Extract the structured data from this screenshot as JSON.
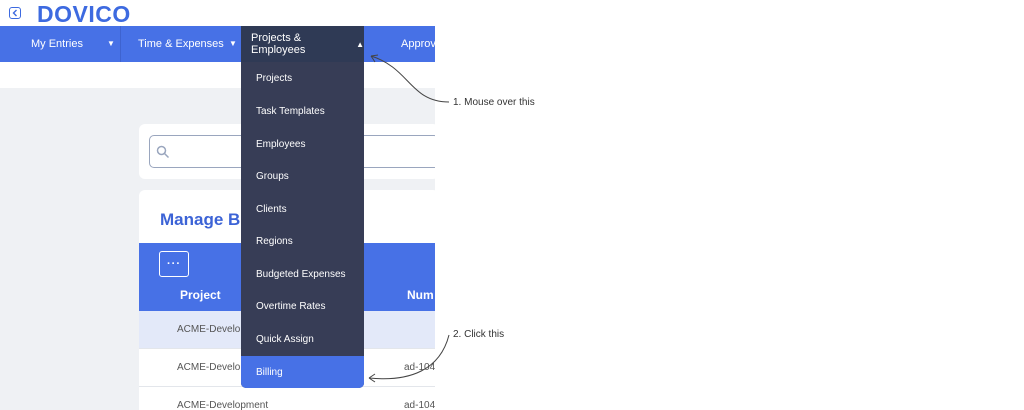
{
  "brand": {
    "logo_text": "DOVICO",
    "accent": "#4771e6"
  },
  "nav": {
    "items": [
      {
        "label": "My Entries"
      },
      {
        "label": "Time & Expenses"
      },
      {
        "label": "Projects & Employees"
      },
      {
        "label": "Approva"
      }
    ]
  },
  "dropdown": {
    "items": [
      {
        "label": "Projects"
      },
      {
        "label": "Task Templates"
      },
      {
        "label": "Employees"
      },
      {
        "label": "Groups"
      },
      {
        "label": "Clients"
      },
      {
        "label": "Regions"
      },
      {
        "label": "Budgeted Expenses"
      },
      {
        "label": "Overtime Rates"
      },
      {
        "label": "Quick Assign"
      },
      {
        "label": "Billing"
      }
    ],
    "active_item": "Billing"
  },
  "page": {
    "title": "Manage B"
  },
  "table": {
    "more_label": "···",
    "columns": [
      "Project",
      "Num"
    ],
    "rows": [
      {
        "project": "ACME-Develop",
        "number": ""
      },
      {
        "project": "ACME-Develop",
        "number": "ad-104"
      },
      {
        "project": "ACME-Development",
        "number": "ad-104"
      }
    ]
  },
  "annotations": {
    "step1": "1. Mouse over this",
    "step2": "2. Click this"
  }
}
